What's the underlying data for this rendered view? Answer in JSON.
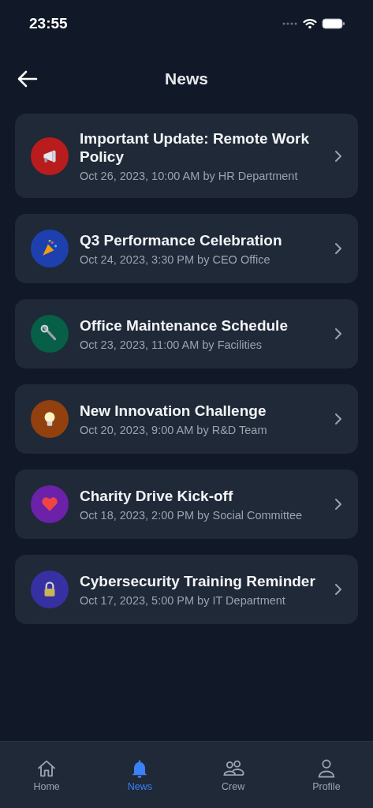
{
  "status_bar": {
    "time": "23:55"
  },
  "header": {
    "title": "News"
  },
  "news": [
    {
      "title": "Important Update: Remote Work Policy",
      "meta": "Oct 26, 2023, 10:00 AM by HR Department",
      "kind": "megaphone",
      "color": "#b91c1c"
    },
    {
      "title": "Q3 Performance Celebration",
      "meta": "Oct 24, 2023, 3:30 PM by CEO Office",
      "kind": "party",
      "color": "#1e40af"
    },
    {
      "title": "Office Maintenance Schedule",
      "meta": "Oct 23, 2023, 11:00 AM by Facilities",
      "kind": "wrench",
      "color": "#065f46"
    },
    {
      "title": "New Innovation Challenge",
      "meta": "Oct 20, 2023, 9:00 AM by R&D Team",
      "kind": "bulb",
      "color": "#92400e"
    },
    {
      "title": "Charity Drive Kick-off",
      "meta": "Oct 18, 2023, 2:00 PM by Social Committee",
      "kind": "heart",
      "color": "#6b21a8"
    },
    {
      "title": "Cybersecurity Training Reminder",
      "meta": "Oct 17, 2023, 5:00 PM by IT Department",
      "kind": "lock",
      "color": "#3730a3"
    }
  ],
  "tab_bar": [
    {
      "label": "Home",
      "kind": "home",
      "selected": false
    },
    {
      "label": "News",
      "kind": "bell",
      "selected": true
    },
    {
      "label": "Crew",
      "kind": "people",
      "selected": false
    },
    {
      "label": "Profile",
      "kind": "person",
      "selected": false
    }
  ]
}
